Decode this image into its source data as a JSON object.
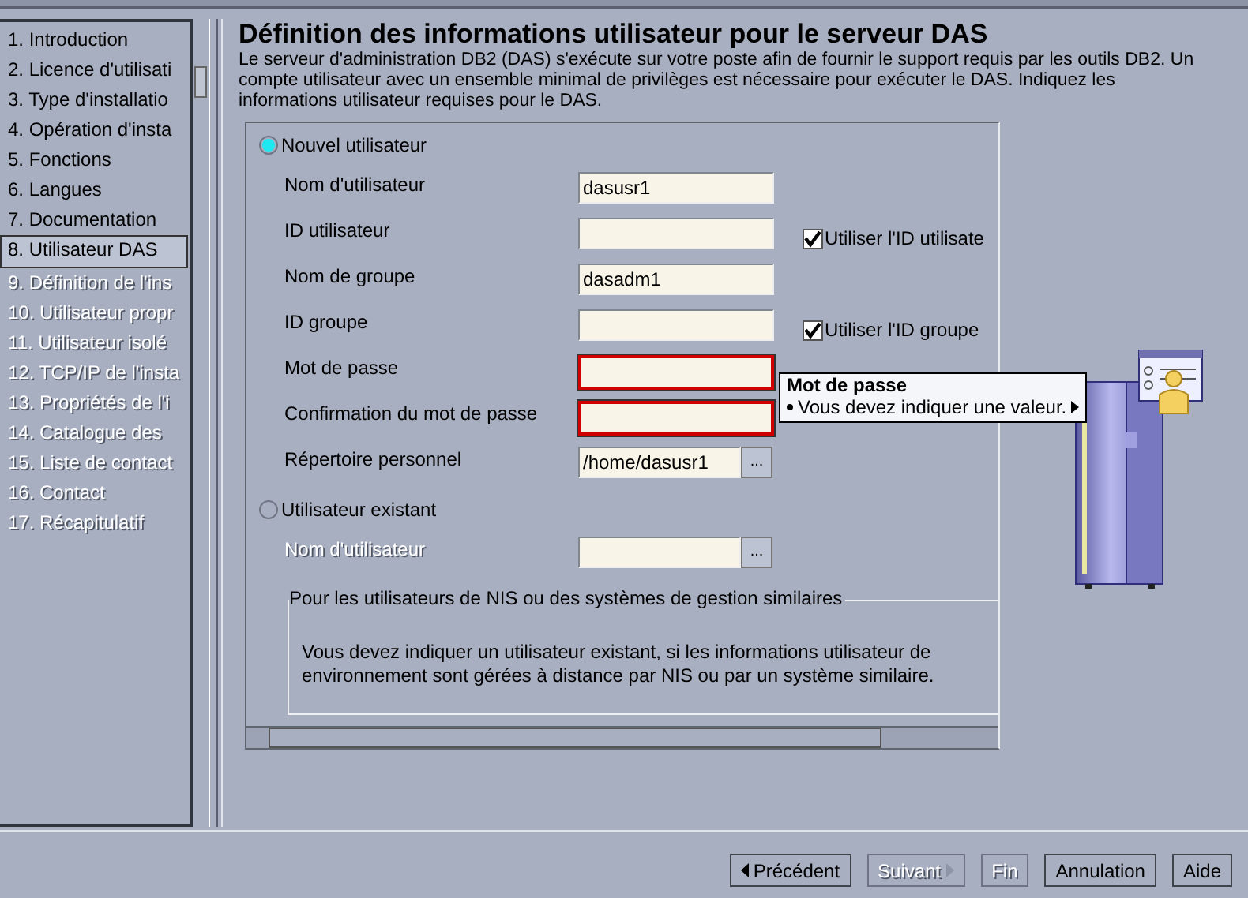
{
  "steps": [
    {
      "label": "1. Introduction",
      "selected": false,
      "disabled": false
    },
    {
      "label": "2. Licence d'utilisati",
      "selected": false,
      "disabled": false
    },
    {
      "label": "3. Type d'installatio",
      "selected": false,
      "disabled": false
    },
    {
      "label": "4. Opération d'insta",
      "selected": false,
      "disabled": false
    },
    {
      "label": "5. Fonctions",
      "selected": false,
      "disabled": false
    },
    {
      "label": "6. Langues",
      "selected": false,
      "disabled": false
    },
    {
      "label": "7. Documentation",
      "selected": false,
      "disabled": false
    },
    {
      "label": "8. Utilisateur DAS",
      "selected": true,
      "disabled": false
    },
    {
      "label": "9. Définition de l'ins",
      "selected": false,
      "disabled": true
    },
    {
      "label": "10. Utilisateur propr",
      "selected": false,
      "disabled": true
    },
    {
      "label": "11. Utilisateur isolé",
      "selected": false,
      "disabled": true
    },
    {
      "label": "12. TCP/IP de l'insta",
      "selected": false,
      "disabled": true
    },
    {
      "label": "13. Propriétés de l'i",
      "selected": false,
      "disabled": true
    },
    {
      "label": "14. Catalogue des",
      "selected": false,
      "disabled": true
    },
    {
      "label": "15. Liste de contact",
      "selected": false,
      "disabled": true
    },
    {
      "label": "16. Contact",
      "selected": false,
      "disabled": true
    },
    {
      "label": "17. Récapitulatif",
      "selected": false,
      "disabled": true
    }
  ],
  "title": "Définition des informations utilisateur pour le serveur DAS",
  "description": "Le serveur d'administration DB2 (DAS) s'exécute sur votre poste afin de fournir le support requis par les outils DB2. Un compte utilisateur avec un ensemble minimal de privilèges est nécessaire pour exécuter le DAS. Indiquez les informations utilisateur requises pour le DAS.",
  "new_user": {
    "label": "Nouvel utilisateur",
    "selected": true,
    "fields": [
      {
        "label": "Nom d'utilisateur",
        "value": "dasusr1"
      },
      {
        "label": "ID utilisateur",
        "checkbox": {
          "label": "Utiliser l'ID utilisate",
          "checked": true
        }
      },
      {
        "label": "Nom de groupe",
        "value": "dasadm1"
      },
      {
        "label": "ID groupe",
        "checkbox": {
          "label": "Utiliser l'ID groupe",
          "checked": true
        }
      },
      {
        "label": "Mot de passe",
        "error": true
      },
      {
        "label": "Confirmation du mot de passe",
        "error": true
      },
      {
        "label": "Répertoire personnel",
        "value": "/home/dasusr1",
        "browse": "..."
      }
    ]
  },
  "tooltip": {
    "title": "Mot de passe",
    "message": "Vous devez indiquer une valeur."
  },
  "existing_user": {
    "label": "Utilisateur existant",
    "selected": false,
    "field": {
      "label": "Nom d'utilisateur",
      "disabled": true,
      "browse": "..."
    },
    "group": {
      "title": "Pour les utilisateurs de NIS ou des systèmes de gestion similaires",
      "text": "Vous devez indiquer un utilisateur existant, si les informations utilisateur de\nenvironnement sont gérées à distance par NIS ou par un système similaire."
    }
  },
  "buttons": [
    {
      "label": "Précédent",
      "kind": "back",
      "disabled": false
    },
    {
      "label": "Suivant",
      "kind": "next",
      "disabled": true
    },
    {
      "label": "Fin",
      "kind": "plain",
      "disabled": true
    },
    {
      "label": "Annulation",
      "kind": "plain",
      "disabled": false
    },
    {
      "label": "Aide",
      "kind": "plain",
      "disabled": false
    }
  ]
}
